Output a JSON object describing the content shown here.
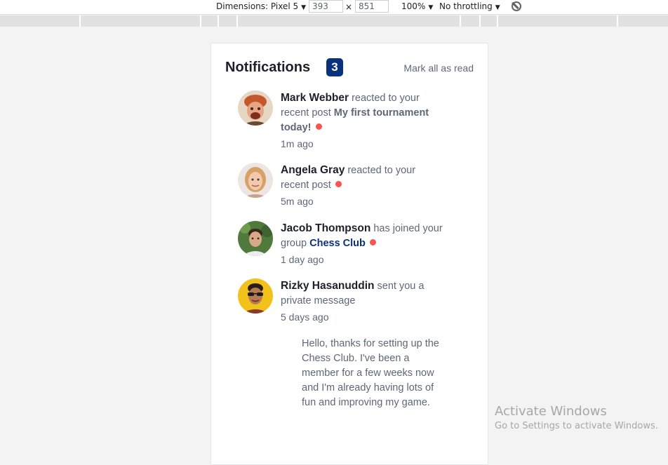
{
  "devtools": {
    "dimensions_label": "Dimensions: Pixel 5",
    "width_value": "393",
    "times": "×",
    "height_value": "851",
    "zoom": "100%",
    "throttling": "No throttling"
  },
  "header": {
    "title": "Notifications",
    "count": "3",
    "mark_all": "Mark all as read"
  },
  "notifications": [
    {
      "name": "Mark Webber",
      "action": "reacted to your recent post",
      "post": "My first tournament today!",
      "time": "1m ago",
      "avatar_icon": "avatar-mark-webber"
    },
    {
      "name": "Angela Gray",
      "action": "reacted to your recent post",
      "time": "5m ago",
      "avatar_icon": "avatar-angela-gray"
    },
    {
      "name": "Jacob Thompson",
      "action": "has joined your group",
      "group": "Chess Club",
      "time": "1 day ago",
      "avatar_icon": "avatar-jacob-thompson"
    },
    {
      "name": "Rizky Hasanuddin",
      "action": "sent you a private message",
      "time": "5 days ago",
      "message": "Hello, thanks for setting up the Chess Club. I've been a member for a few weeks now and I'm already having lots of fun and improving my game.",
      "avatar_icon": "avatar-rizky-hasanuddin"
    }
  ],
  "watermark": {
    "line1": "Activate Windows",
    "line2": "Go to Settings to activate Windows."
  },
  "colors": {
    "badge": "#0a317b",
    "unread_dot": "#f65552",
    "name_text": "#1c202b",
    "body_text": "#5e6778"
  }
}
